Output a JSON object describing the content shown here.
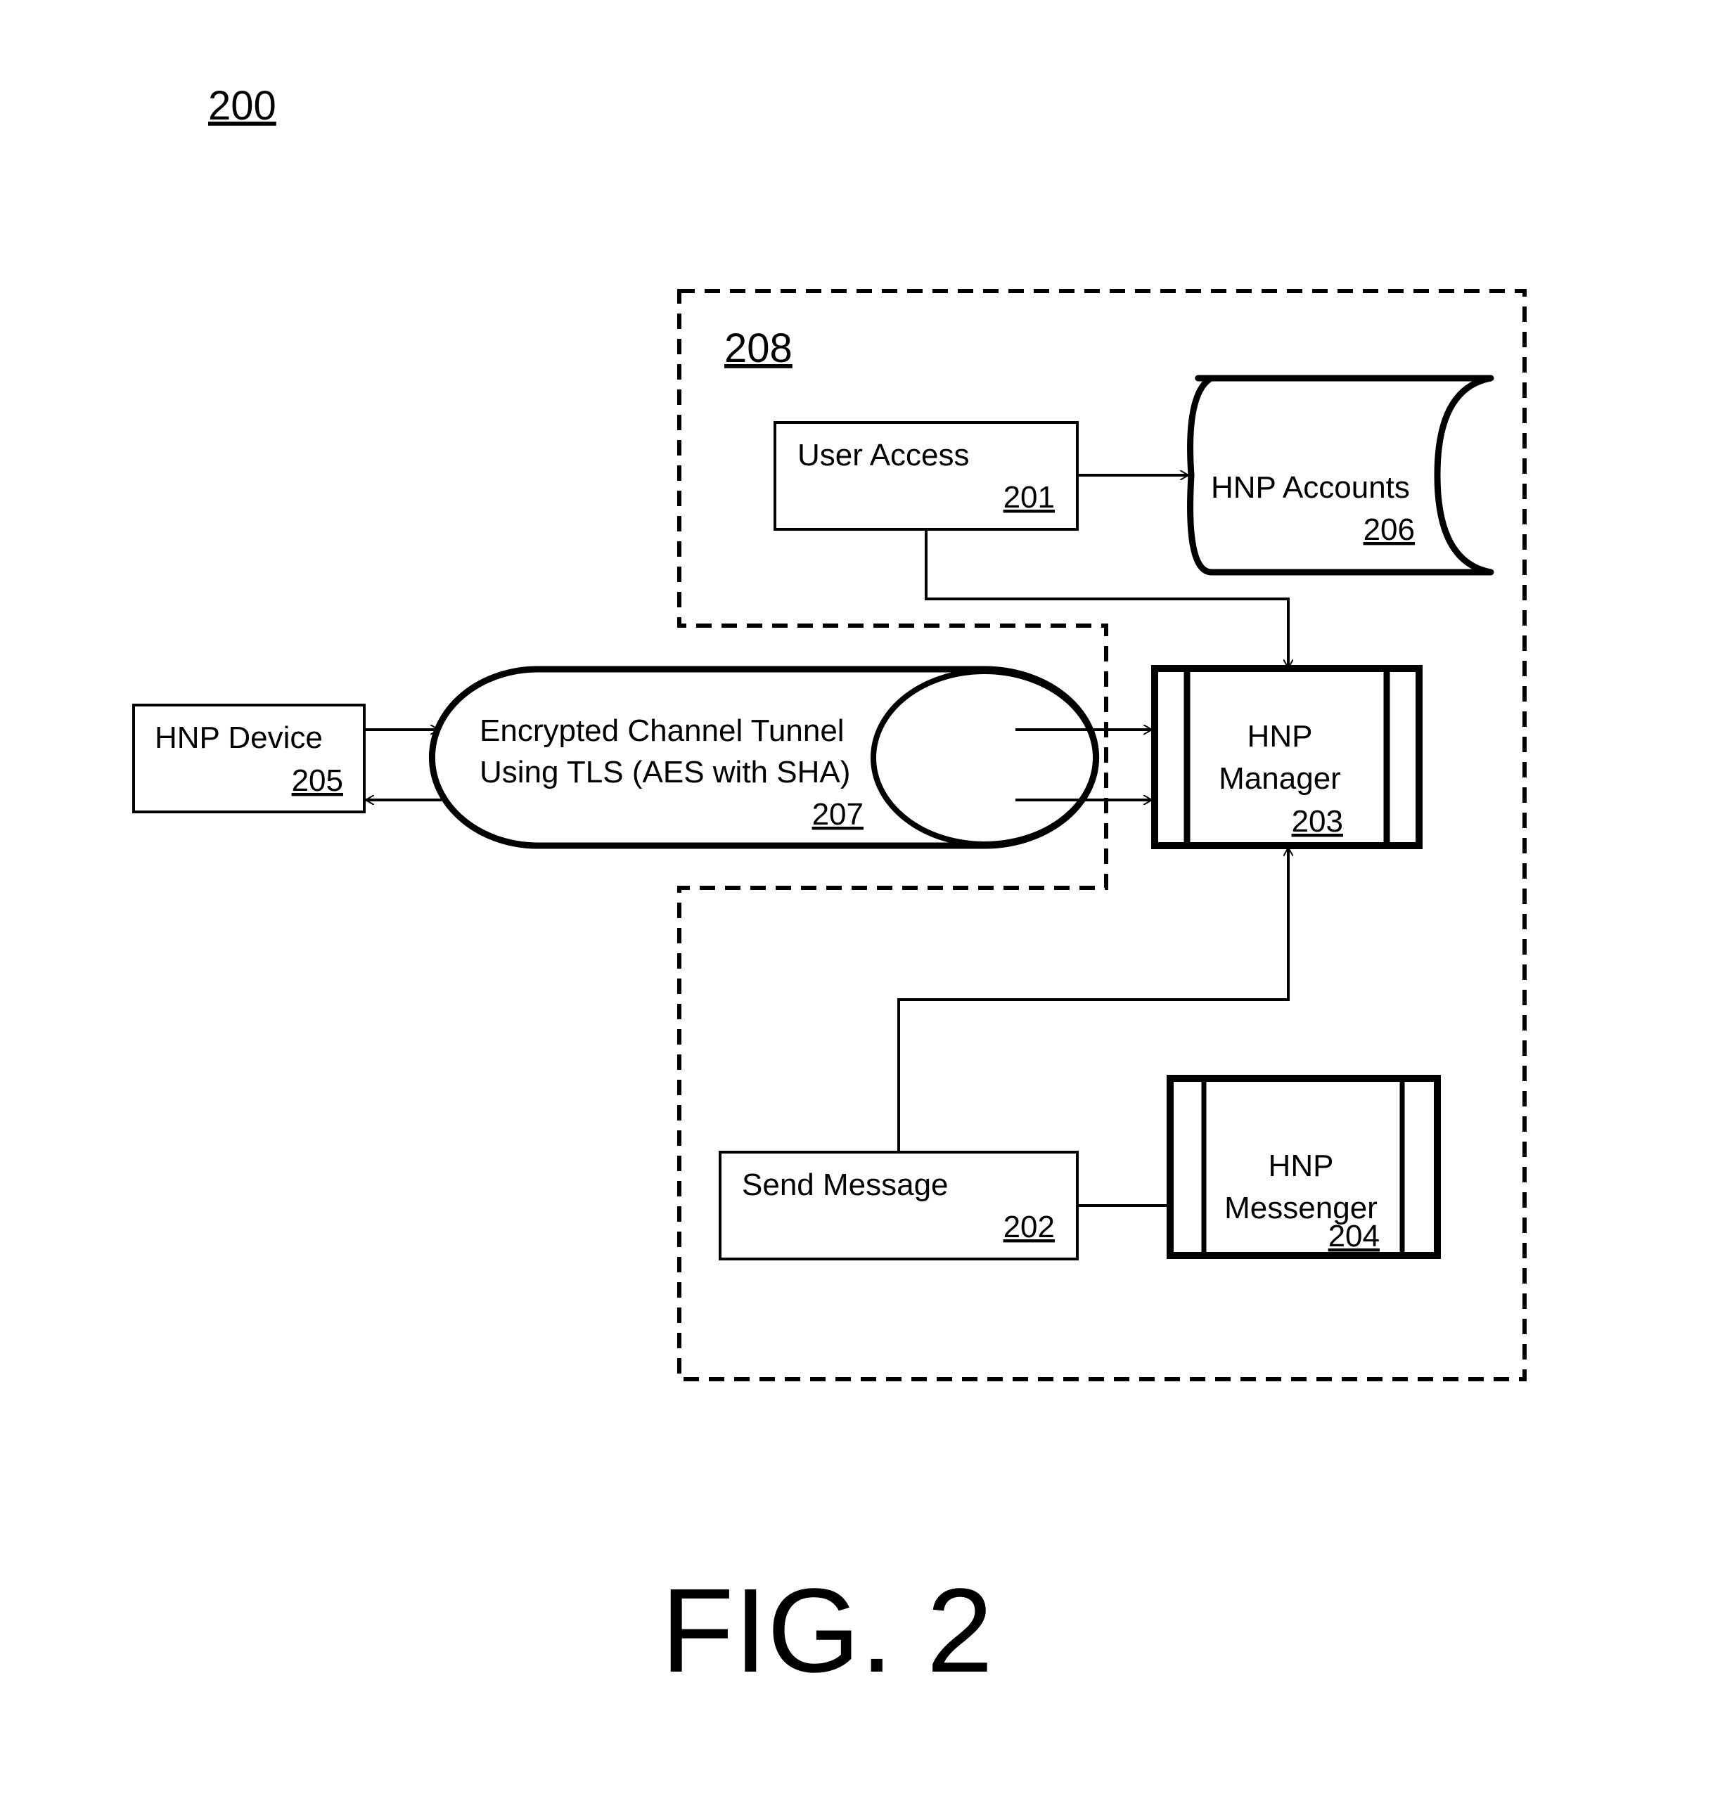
{
  "figure": {
    "number_label": "200",
    "caption": "FIG. 2"
  },
  "boundary": {
    "label": "208"
  },
  "nodes": {
    "user_access": {
      "label": "User Access",
      "ref": "201"
    },
    "send_message": {
      "label": "Send Message",
      "ref": "202"
    },
    "hnp_manager": {
      "label_line1": "HNP",
      "label_line2": "Manager",
      "ref": "203"
    },
    "hnp_messenger": {
      "label_line1": "HNP",
      "label_line2": "Messenger",
      "ref": "204"
    },
    "hnp_device": {
      "label": "HNP Device",
      "ref": "205"
    },
    "hnp_accounts": {
      "label": "HNP Accounts",
      "ref": "206"
    },
    "tunnel": {
      "label_line1": "Encrypted Channel Tunnel",
      "label_line2": "Using TLS (AES with SHA)",
      "ref": "207"
    }
  },
  "edges": [
    {
      "from": "user_access",
      "to": "hnp_accounts",
      "arrow": "to"
    },
    {
      "from": "user_access",
      "to": "hnp_manager",
      "arrow": "to"
    },
    {
      "from": "send_message",
      "to": "hnp_manager",
      "arrow": "to"
    },
    {
      "from": "send_message",
      "to": "hnp_messenger",
      "arrow": "none"
    },
    {
      "from": "hnp_device",
      "to": "tunnel",
      "arrow": "to"
    },
    {
      "from": "tunnel",
      "to": "hnp_device",
      "arrow": "to"
    },
    {
      "from": "tunnel",
      "to": "hnp_manager",
      "arrow": "to"
    },
    {
      "from": "tunnel",
      "to": "hnp_manager",
      "arrow": "to"
    }
  ]
}
